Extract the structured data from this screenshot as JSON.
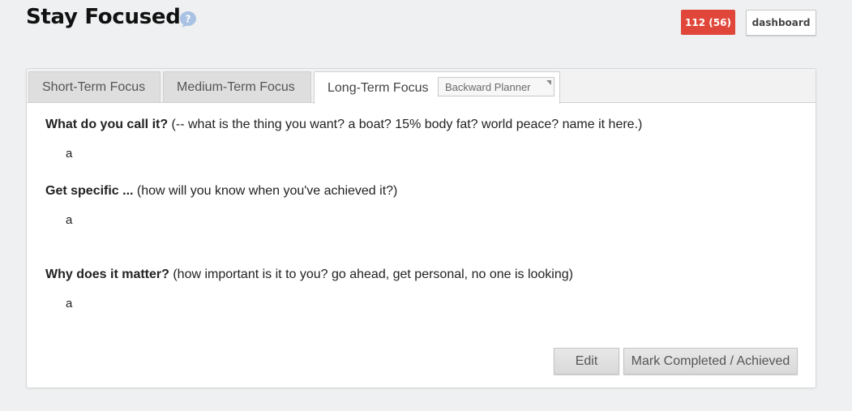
{
  "header": {
    "title": "Stay Focused",
    "badge": "112 (56)",
    "dashboard_label": "dashboard"
  },
  "tabs": [
    {
      "label": "Short-Term Focus",
      "active": false
    },
    {
      "label": "Medium-Term Focus",
      "active": false
    },
    {
      "label": "Long-Term Focus",
      "active": true
    }
  ],
  "planner_select": {
    "selected": "Backward Planner"
  },
  "questions": [
    {
      "title": "What do you call it?",
      "hint": " (-- what is the thing you want? a boat? 15% body fat? world peace? name it here.)",
      "answer": "a"
    },
    {
      "title": "Get specific ...",
      "hint": " (how will you know when you've achieved it?)",
      "answer": "a"
    },
    {
      "title": "Why does it matter?",
      "hint": " (how important is it to you? go ahead, get personal, no one is looking)",
      "answer": "a"
    }
  ],
  "actions": {
    "edit_label": "Edit",
    "complete_label": "Mark Completed / Achieved"
  },
  "colors": {
    "badge": "#e0473a",
    "help_icon": "#a9c2e4",
    "background": "#eef0f1"
  },
  "icons": {
    "help": "question-bubble-icon",
    "select_caret": "caret-icon"
  }
}
